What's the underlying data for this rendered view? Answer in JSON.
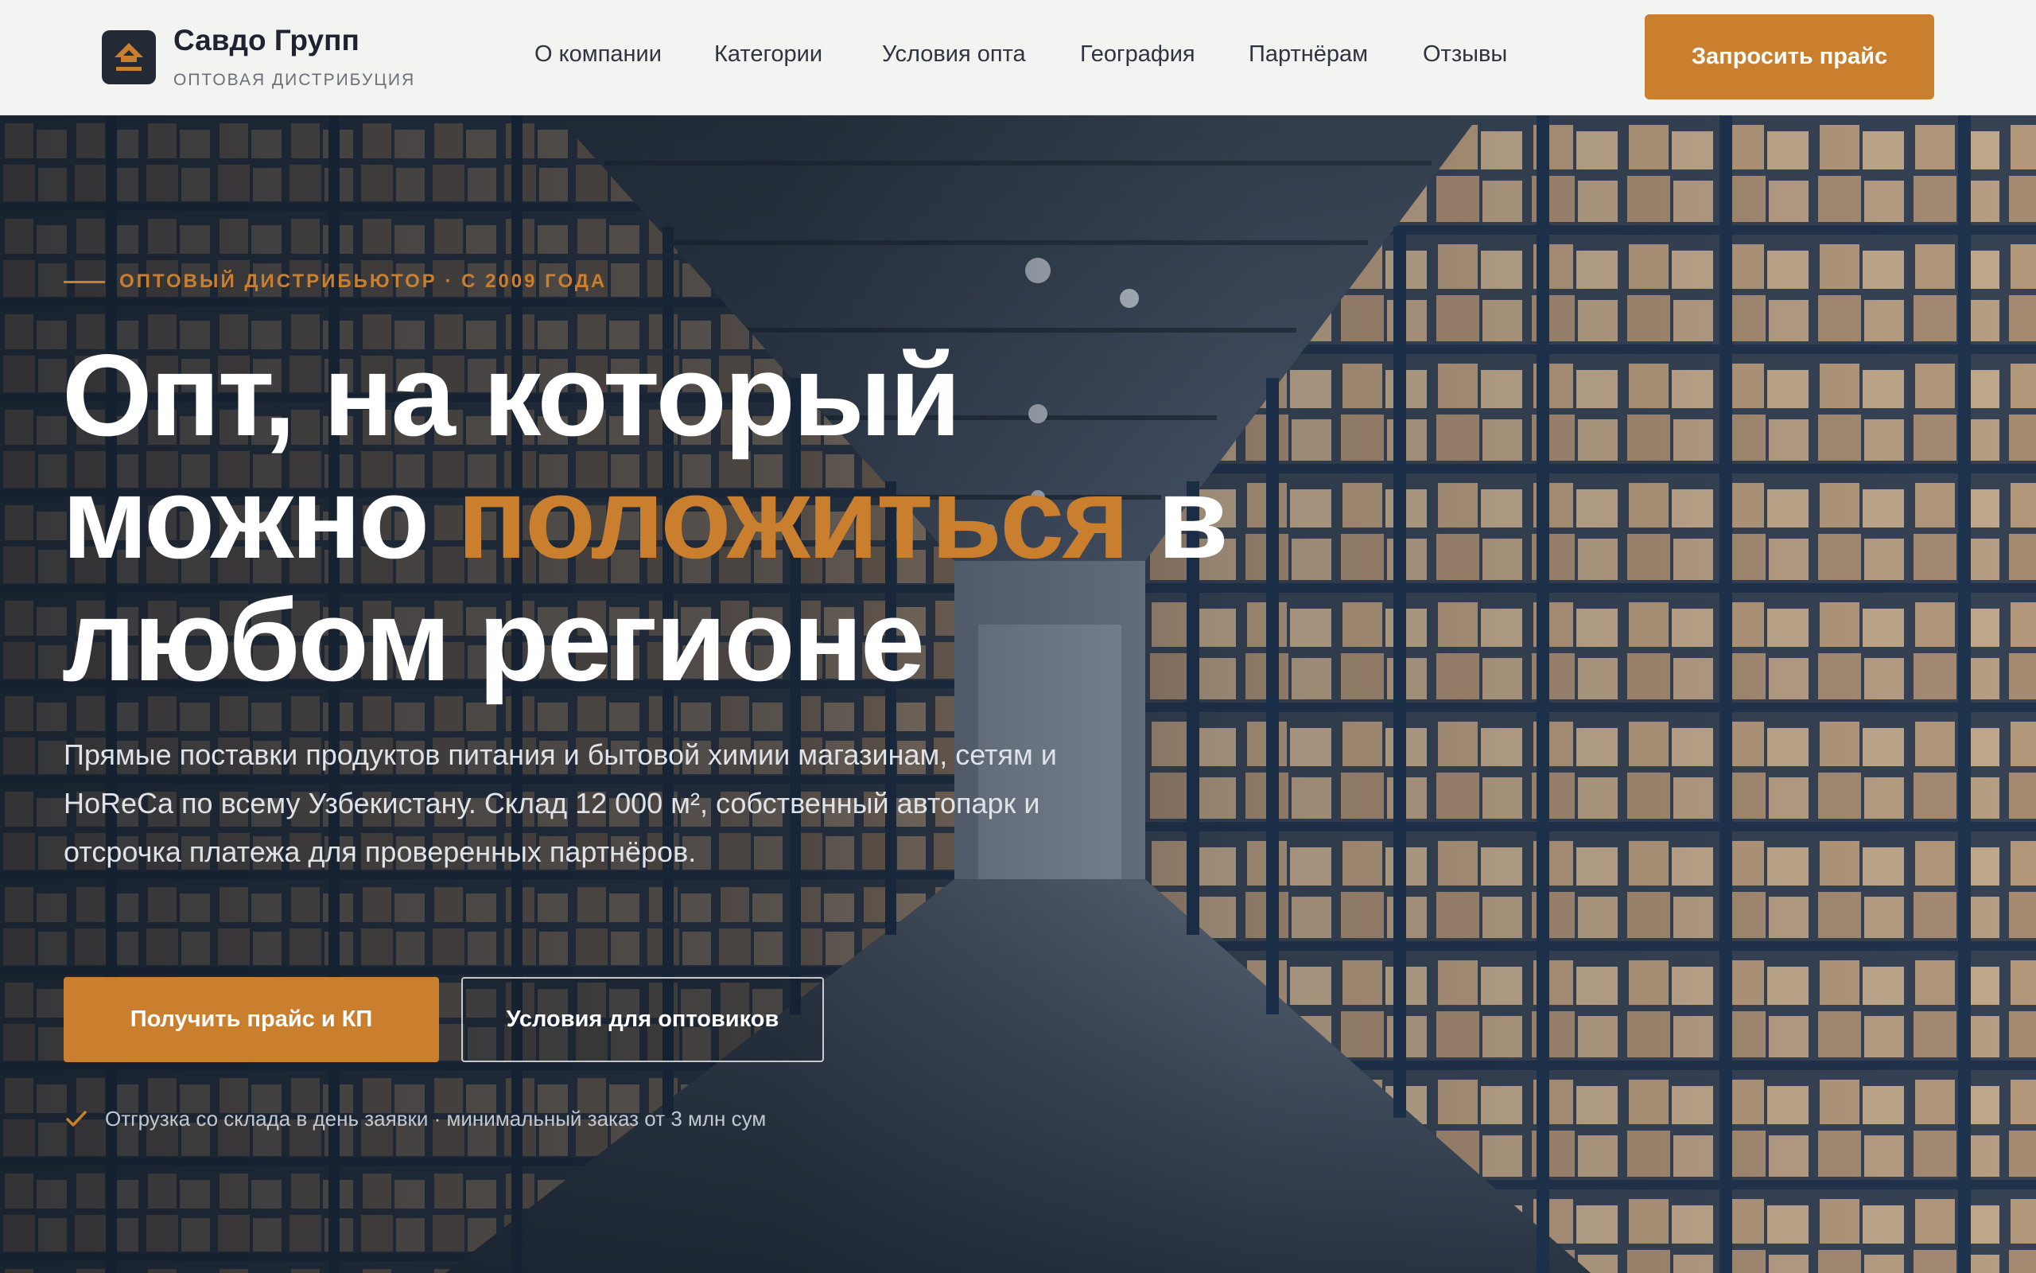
{
  "brand": {
    "name": "Савдо Групп",
    "tagline": "ОПТОВАЯ ДИСТРИБУЦИЯ",
    "logo_icon": "house-arrow-icon"
  },
  "nav": {
    "items": [
      {
        "label": "О компании"
      },
      {
        "label": "Категории"
      },
      {
        "label": "Условия опта"
      },
      {
        "label": "География"
      },
      {
        "label": "Партнёрам"
      },
      {
        "label": "Отзывы"
      }
    ],
    "cta_label": "Запросить прайс"
  },
  "hero": {
    "eyebrow": "ОПТОВЫЙ ДИСТРИБЬЮТОР · С 2009 ГОДА",
    "headline_part1": "Опт, на который можно ",
    "headline_accent": "положиться",
    "headline_part2": " в любом регионе",
    "lead": "Прямые поставки продуктов питания и бытовой химии магазинам, сетям и HoReCa по всему Узбекистану. Склад 12 000 м², собственный автопарк и отсрочка платежа для проверенных партнёров.",
    "primary_button": "Получить прайс и КП",
    "secondary_button": "Условия для оптовиков",
    "note_icon": "check-icon",
    "note": "Отгрузка со склада в день заявки · минимальный заказ от 3 млн сум",
    "background_image": "warehouse-aisle-photo"
  },
  "colors": {
    "accent": "#c97f2e",
    "header_bg": "#f3f3f1",
    "text_dark": "#1d2330",
    "hero_text": "#ffffff"
  }
}
